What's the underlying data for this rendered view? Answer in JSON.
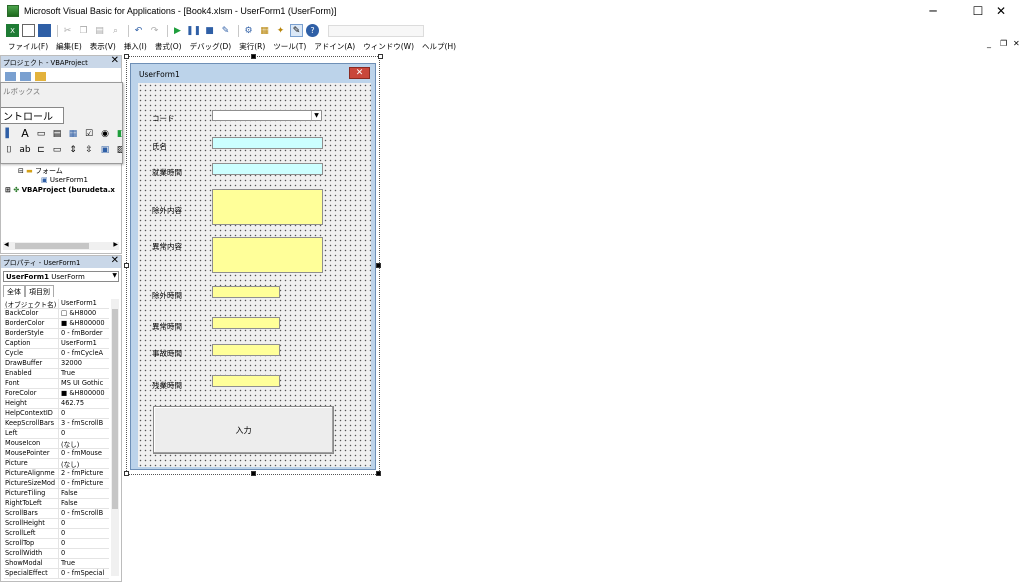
{
  "window": {
    "title": "Microsoft Visual Basic for Applications - [Book4.xlsm - UserForm1 (UserForm)]",
    "minimize": "─",
    "maximize": "☐",
    "close": "✕"
  },
  "menu": {
    "items": [
      "ファイル(F)",
      "編集(E)",
      "表示(V)",
      "挿入(I)",
      "書式(O)",
      "デバッグ(D)",
      "実行(R)",
      "ツール(T)",
      "アドイン(A)",
      "ウィンドウ(W)",
      "ヘルプ(H)"
    ],
    "mdi_min": "_",
    "mdi_restore": "❐",
    "mdi_close": "✕"
  },
  "project_panel": {
    "title": "プロジェクト - VBAProject",
    "close": "✕",
    "tree": {
      "forms_folder": "フォーム",
      "userform": "UserForm1",
      "project": "VBAProject (burudeta.x"
    }
  },
  "toolbox": {
    "title": "ルボックス",
    "tab": "ントロール"
  },
  "properties_panel": {
    "title": "プロパティ - UserForm1",
    "close": "✕",
    "object_bold": "UserForm1",
    "object_type": "UserForm",
    "tab_all": "全体",
    "tab_category": "項目別",
    "rows": [
      {
        "name": "(オブジェクト名)",
        "value": "UserForm1"
      },
      {
        "name": "BackColor",
        "value": "□ &H8000"
      },
      {
        "name": "BorderColor",
        "value": "■ &H800000"
      },
      {
        "name": "BorderStyle",
        "value": "0 - fmBorder"
      },
      {
        "name": "Caption",
        "value": "UserForm1"
      },
      {
        "name": "Cycle",
        "value": "0 - fmCycleA"
      },
      {
        "name": "DrawBuffer",
        "value": "32000"
      },
      {
        "name": "Enabled",
        "value": "True"
      },
      {
        "name": "Font",
        "value": "MS UI Gothic"
      },
      {
        "name": "ForeColor",
        "value": "■ &H800000"
      },
      {
        "name": "Height",
        "value": "462.75"
      },
      {
        "name": "HelpContextID",
        "value": "0"
      },
      {
        "name": "KeepScrollBars",
        "value": "3 - fmScrollB"
      },
      {
        "name": "Left",
        "value": "0"
      },
      {
        "name": "MouseIcon",
        "value": "(なし)"
      },
      {
        "name": "MousePointer",
        "value": "0 - fmMouse"
      },
      {
        "name": "Picture",
        "value": "(なし)"
      },
      {
        "name": "PictureAlignme",
        "value": "2 - fmPicture"
      },
      {
        "name": "PictureSizeMod",
        "value": "0 - fmPicture"
      },
      {
        "name": "PictureTiling",
        "value": "False"
      },
      {
        "name": "RightToLeft",
        "value": "False"
      },
      {
        "name": "ScrollBars",
        "value": "0 - fmScrollB"
      },
      {
        "name": "ScrollHeight",
        "value": "0"
      },
      {
        "name": "ScrollLeft",
        "value": "0"
      },
      {
        "name": "ScrollTop",
        "value": "0"
      },
      {
        "name": "ScrollWidth",
        "value": "0"
      },
      {
        "name": "ShowModal",
        "value": "True"
      },
      {
        "name": "SpecialEffect",
        "value": "0 - fmSpecial"
      }
    ]
  },
  "userform": {
    "caption": "UserForm1",
    "close": "✕",
    "labels": {
      "code": "コード",
      "name": "氏名",
      "work_hours": "就業時間",
      "exclusion_content": "除外内容",
      "abnormal_content": "異常内容",
      "exclusion_hours": "除外時間",
      "abnormal_hours": "異常時間",
      "accident_hours": "事故時間",
      "overtime_hours": "残業時間"
    },
    "submit_button": "入力"
  },
  "colors": {
    "cyan_field": "#ccffff",
    "yellow_field": "#ffff99",
    "panel_header": "#c9d7e8",
    "form_border": "#bcd3ea"
  }
}
